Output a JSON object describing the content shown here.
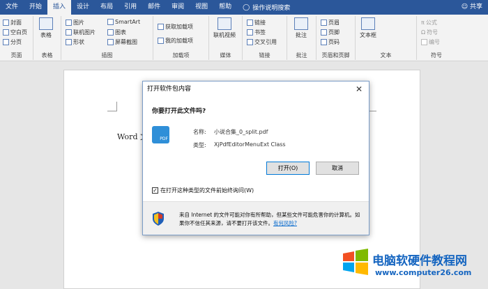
{
  "tabs": [
    "文件",
    "开始",
    "插入",
    "设计",
    "布局",
    "引用",
    "邮件",
    "审阅",
    "视图",
    "帮助"
  ],
  "active_tab": "插入",
  "tell_me": "操作说明搜索",
  "share": "共享",
  "ribbon": {
    "pages": {
      "cover": "封面",
      "blank": "空白页",
      "break": "分页",
      "label": "页面"
    },
    "table": {
      "button": "表格",
      "label": "表格"
    },
    "illustrations": {
      "picture": "图片",
      "online_picture": "联机图片",
      "shapes": "形状",
      "smartart": "SmartArt",
      "chart": "图表",
      "screenshot": "屏幕截图",
      "label": "插图"
    },
    "addins": {
      "get": "获取加载项",
      "mine": "我的加载项",
      "label": "加载项"
    },
    "media": {
      "online_video": "联机视频",
      "label": "媒体"
    },
    "links": {
      "link": "链接",
      "bookmark": "书签",
      "cross_ref": "交叉引用",
      "label": "链接"
    },
    "comments": {
      "comment": "批注",
      "label": "批注"
    },
    "header_footer": {
      "header": "页眉",
      "footer": "页脚",
      "page_number": "页码",
      "label": "页眉和页脚"
    },
    "text": {
      "textbox": "文本框",
      "label": "文本"
    },
    "symbols": {
      "equation": "公式",
      "symbol": "符号",
      "number": "编号",
      "label": "符号"
    }
  },
  "document": {
    "visible_text": "Word 文"
  },
  "dialog": {
    "title": "打开软件包内容",
    "question": "你要打开此文件吗?",
    "name_label": "名称:",
    "name_value": "小说合集_0_split.pdf",
    "type_label": "类型:",
    "type_value": "XjPdfEditorMenuExt Class",
    "open_button": "打开(O)",
    "cancel_button": "取消",
    "checkbox_label": "在打开这种类型的文件前始终询问(W)",
    "checkbox_checked": true,
    "warning_text": "来自 Internet 的文件可能对你有所帮助，但某些文件可能危害你的计算机。如果你不信任其来源，请不要打开该文件。",
    "risk_link": "有何风险?",
    "icon_text": "PDF"
  },
  "watermark": {
    "title": "电脑软硬件教程网",
    "url": "www.computer26.com"
  },
  "colors": {
    "ribbon_blue": "#2b579a",
    "link": "#0066cc",
    "watermark": "#1565c0"
  }
}
